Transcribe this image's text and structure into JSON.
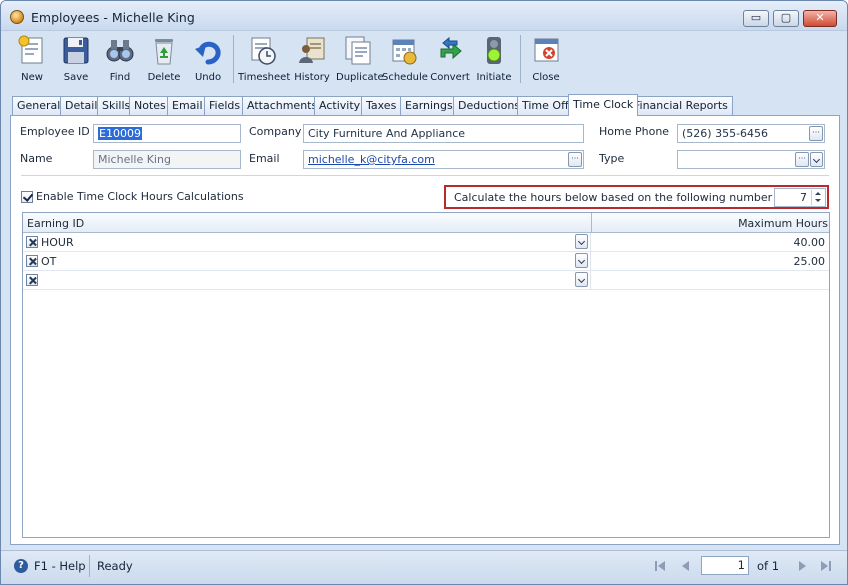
{
  "window": {
    "title": "Employees - Michelle King",
    "min_label": "▭",
    "max_label": "▢",
    "close_label": "✕"
  },
  "toolbar": [
    {
      "label": "New",
      "icon": "new-document-icon"
    },
    {
      "label": "Save",
      "icon": "floppy-disk-icon"
    },
    {
      "label": "Find",
      "icon": "binoculars-icon"
    },
    {
      "label": "Delete",
      "icon": "recycle-bin-icon"
    },
    {
      "label": "Undo",
      "icon": "undo-arrow-icon"
    },
    {
      "label": "Timesheet",
      "icon": "timesheet-clock-icon"
    },
    {
      "label": "History",
      "icon": "history-person-icon"
    },
    {
      "label": "Duplicate",
      "icon": "duplicate-icon"
    },
    {
      "label": "Schedule",
      "icon": "schedule-icon"
    },
    {
      "label": "Convert",
      "icon": "convert-arrows-icon"
    },
    {
      "label": "Initiate",
      "icon": "traffic-light-icon"
    },
    {
      "label": "Close",
      "icon": "close-window-icon"
    }
  ],
  "tabs": [
    "General",
    "Detail",
    "Skills",
    "Notes",
    "Email",
    "Fields",
    "Attachments",
    "Activity",
    "Taxes",
    "Earnings",
    "Deductions",
    "Time Off",
    "Time Clock",
    "Financial Reports"
  ],
  "active_tab": "Time Clock",
  "form": {
    "employee_id_label": "Employee ID",
    "employee_id": "E10009",
    "name_label": "Name",
    "name": "Michelle King",
    "company_label": "Company",
    "company": "City Furniture And Appliance",
    "email_label": "Email",
    "email": "michelle_k@cityfa.com",
    "home_phone_label": "Home Phone",
    "home_phone": "(526) 355-6456",
    "type_label": "Type",
    "type": "",
    "dots": "···"
  },
  "timeclock": {
    "enable_label": "Enable Time Clock Hours Calculations",
    "enabled": true,
    "days_label": "Calculate the hours below based on the following number of days",
    "days": "7"
  },
  "grid": {
    "headers": [
      "Earning ID",
      "Maximum Hours"
    ],
    "rows": [
      {
        "earning_id": "HOUR",
        "max_hours": "40.00"
      },
      {
        "earning_id": "OT",
        "max_hours": "25.00"
      },
      {
        "earning_id": "",
        "max_hours": ""
      }
    ]
  },
  "status": {
    "help": "F1 - Help",
    "state": "Ready",
    "page": "1",
    "of_label": "of 1",
    "help_glyph": "?"
  },
  "colors": {
    "highlight_border": "#b9292d",
    "selection": "#2c6bd8"
  }
}
